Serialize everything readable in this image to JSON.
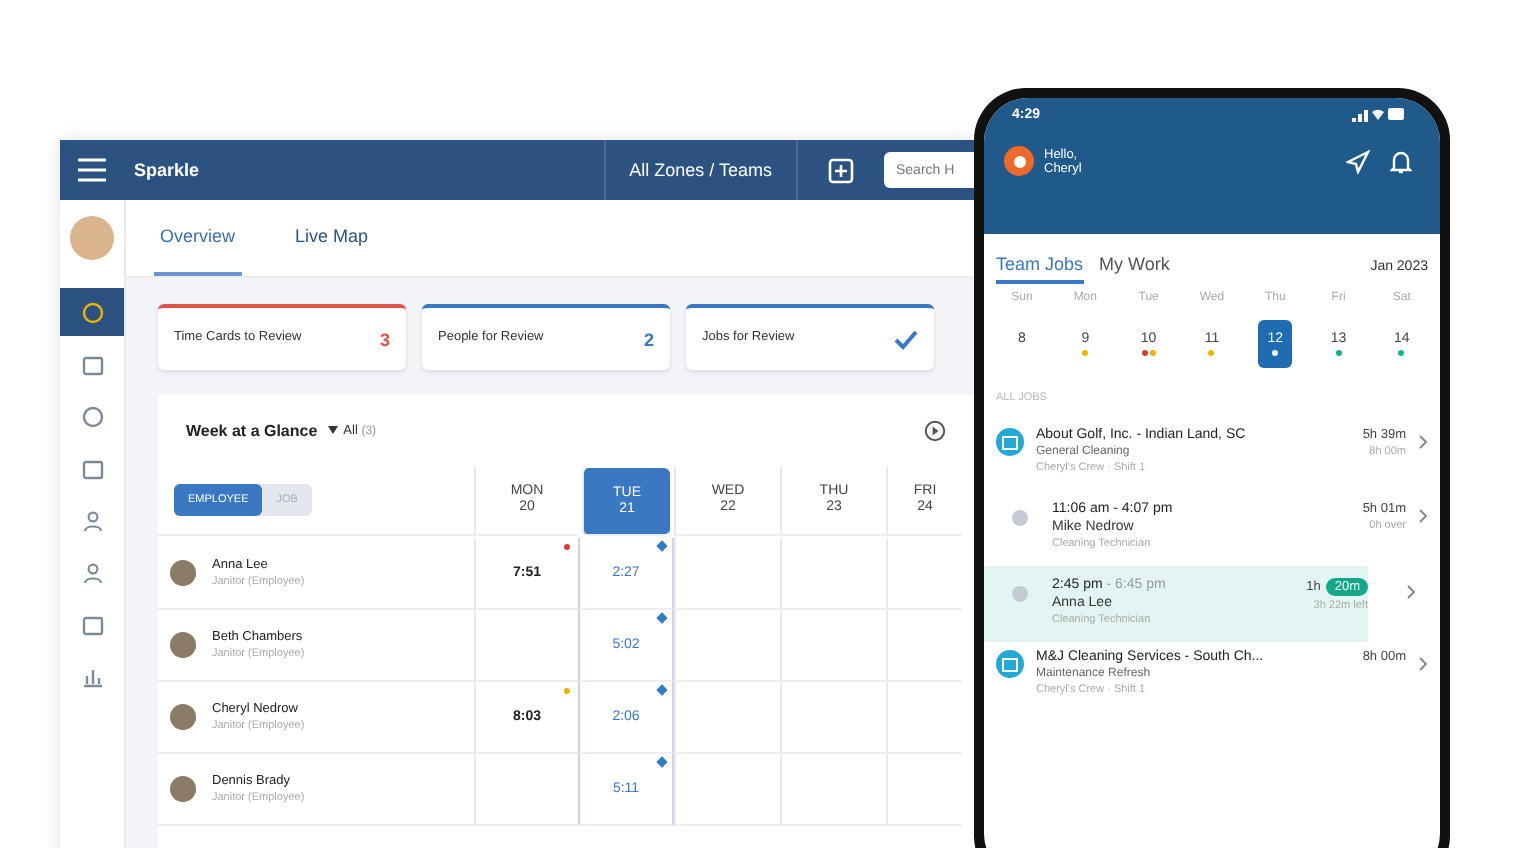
{
  "app": {
    "title": "Sparkle",
    "zone": "All Zones / Teams",
    "search": {
      "placeholder": "Search H"
    }
  },
  "sidebar": {
    "items": [
      {
        "selected": true
      },
      {
        "selected": false
      },
      {
        "selected": false
      },
      {
        "selected": false
      },
      {
        "selected": false
      },
      {
        "selected": false
      },
      {
        "selected": false
      },
      {
        "selected": false
      }
    ]
  },
  "tabs": [
    {
      "label": "Overview",
      "selected": true
    },
    {
      "label": "Live Map",
      "selected": false
    }
  ],
  "summary_cards": [
    {
      "kind": "count",
      "label": "Time Cards to Review",
      "count": "3",
      "color": "#e0534a"
    },
    {
      "kind": "count",
      "label": "People for Review",
      "count": "2",
      "color": "#3b78c4"
    },
    {
      "kind": "check",
      "label": "Jobs for Review",
      "color": "#3b78c4"
    }
  ],
  "week": {
    "title": "Week at a Glance",
    "filter": "All",
    "count": "(3)",
    "toggle": [
      {
        "label": "EMPLOYEE",
        "selected": true
      },
      {
        "label": "JOB",
        "selected": false
      }
    ],
    "days": [
      {
        "name": "MON",
        "date": "20",
        "selected": false
      },
      {
        "name": "TUE",
        "date": "21",
        "selected": true
      },
      {
        "name": "WED",
        "date": "22",
        "selected": false
      },
      {
        "name": "THU",
        "date": "23",
        "selected": false
      },
      {
        "name": "FRI",
        "date": "24",
        "selected": false
      }
    ],
    "rows": [
      {
        "name": "Anna Lee",
        "role": "Janitor (Employee)",
        "mon": "7:51",
        "tue": "2:27",
        "flag": {
          "color": "#e03b3b"
        }
      },
      {
        "name": "Beth Chambers",
        "role": "Janitor (Employee)",
        "tue": "5:02"
      },
      {
        "name": "Cheryl Nedrow",
        "role": "Janitor (Employee)",
        "mon": "8:03",
        "tue": "2:06",
        "flag": {
          "color": "#f0b400"
        }
      },
      {
        "name": "Dennis Brady",
        "role": "Janitor (Employee)",
        "tue": "5:11"
      }
    ]
  },
  "phone": {
    "time": "4:29",
    "greeting": "Hello,",
    "user": "Cheryl",
    "tabs": [
      {
        "label": "Team Jobs",
        "selected": true
      },
      {
        "label": "My Work",
        "selected": false
      }
    ],
    "month": "Jan 2023",
    "days": [
      {
        "name": "Sun",
        "date": "8",
        "selected": false
      },
      {
        "name": "Mon",
        "date": "9",
        "selected": false,
        "dots": [
          {
            "color": "#f0b400"
          }
        ]
      },
      {
        "name": "Tue",
        "date": "10",
        "selected": false,
        "dots": [
          {
            "color": "#e03b3b"
          },
          {
            "color": "#f0b400"
          }
        ]
      },
      {
        "name": "Wed",
        "date": "11",
        "selected": false,
        "dots": [
          {
            "color": "#f0b400"
          }
        ]
      },
      {
        "name": "Thu",
        "date": "12",
        "selected": true,
        "dots": [
          {
            "color": "#ffffff"
          }
        ]
      },
      {
        "name": "Fri",
        "date": "13",
        "selected": false,
        "dots": [
          {
            "color": "#18b28a"
          }
        ]
      },
      {
        "name": "Sat",
        "date": "14",
        "selected": false,
        "dots": [
          {
            "color": "#18b28a"
          }
        ]
      }
    ],
    "section": "ALL JOBS",
    "jobs": [
      {
        "kind": "job",
        "title": "About Golf, Inc. - Indian Land, SC",
        "subtitle": "General Cleaning",
        "crew": "Cheryl's Crew · Shift 1",
        "duration": "5h 39m",
        "planned": "8h 00m"
      },
      {
        "kind": "shift",
        "selected": false,
        "time": "11:06 am - 4:07 pm",
        "name": "Mike Nedrow",
        "role": "Cleaning Technician",
        "duration": "5h 01m",
        "note": "0h over"
      },
      {
        "kind": "shift",
        "selected": true,
        "time": "2:45 pm",
        "end": " - 6:45 pm",
        "name": "Anna Lee",
        "role": "Cleaning Technician",
        "duration": "1h",
        "badge": "20m",
        "note": "3h 22m left"
      },
      {
        "kind": "job",
        "title": "M&J Cleaning Services - South Ch...",
        "subtitle": "Maintenance Refresh",
        "crew": "Cheryl's Crew · Shift 1",
        "duration": "8h 00m"
      }
    ]
  }
}
